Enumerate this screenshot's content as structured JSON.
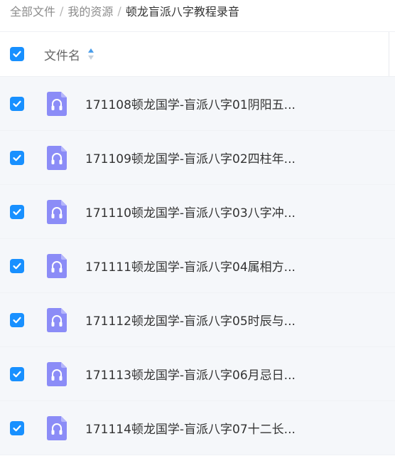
{
  "breadcrumb": {
    "items": [
      "全部文件",
      "我的资源"
    ],
    "separator": "/",
    "current": "顿龙盲派八字教程录音"
  },
  "table": {
    "column_name": "文件名",
    "all_selected": true,
    "rows": [
      {
        "name": "171108顿龙国学-盲派八字01阴阳五...",
        "selected": true,
        "icon": "audio-file-icon"
      },
      {
        "name": "171109顿龙国学-盲派八字02四柱年...",
        "selected": true,
        "icon": "audio-file-icon"
      },
      {
        "name": "171110顿龙国学-盲派八字03八字冲...",
        "selected": true,
        "icon": "audio-file-icon"
      },
      {
        "name": "171111顿龙国学-盲派八字04属相方...",
        "selected": true,
        "icon": "audio-file-icon"
      },
      {
        "name": "171112顿龙国学-盲派八字05时辰与...",
        "selected": true,
        "icon": "audio-file-icon"
      },
      {
        "name": "171113顿龙国学-盲派八字06月忌日...",
        "selected": true,
        "icon": "audio-file-icon"
      },
      {
        "name": "171114顿龙国学-盲派八字07十二长...",
        "selected": true,
        "icon": "audio-file-icon"
      }
    ]
  },
  "colors": {
    "accent": "#1890ff",
    "file_icon": "#8b8cf7",
    "row_background": "#f5f7fa"
  }
}
